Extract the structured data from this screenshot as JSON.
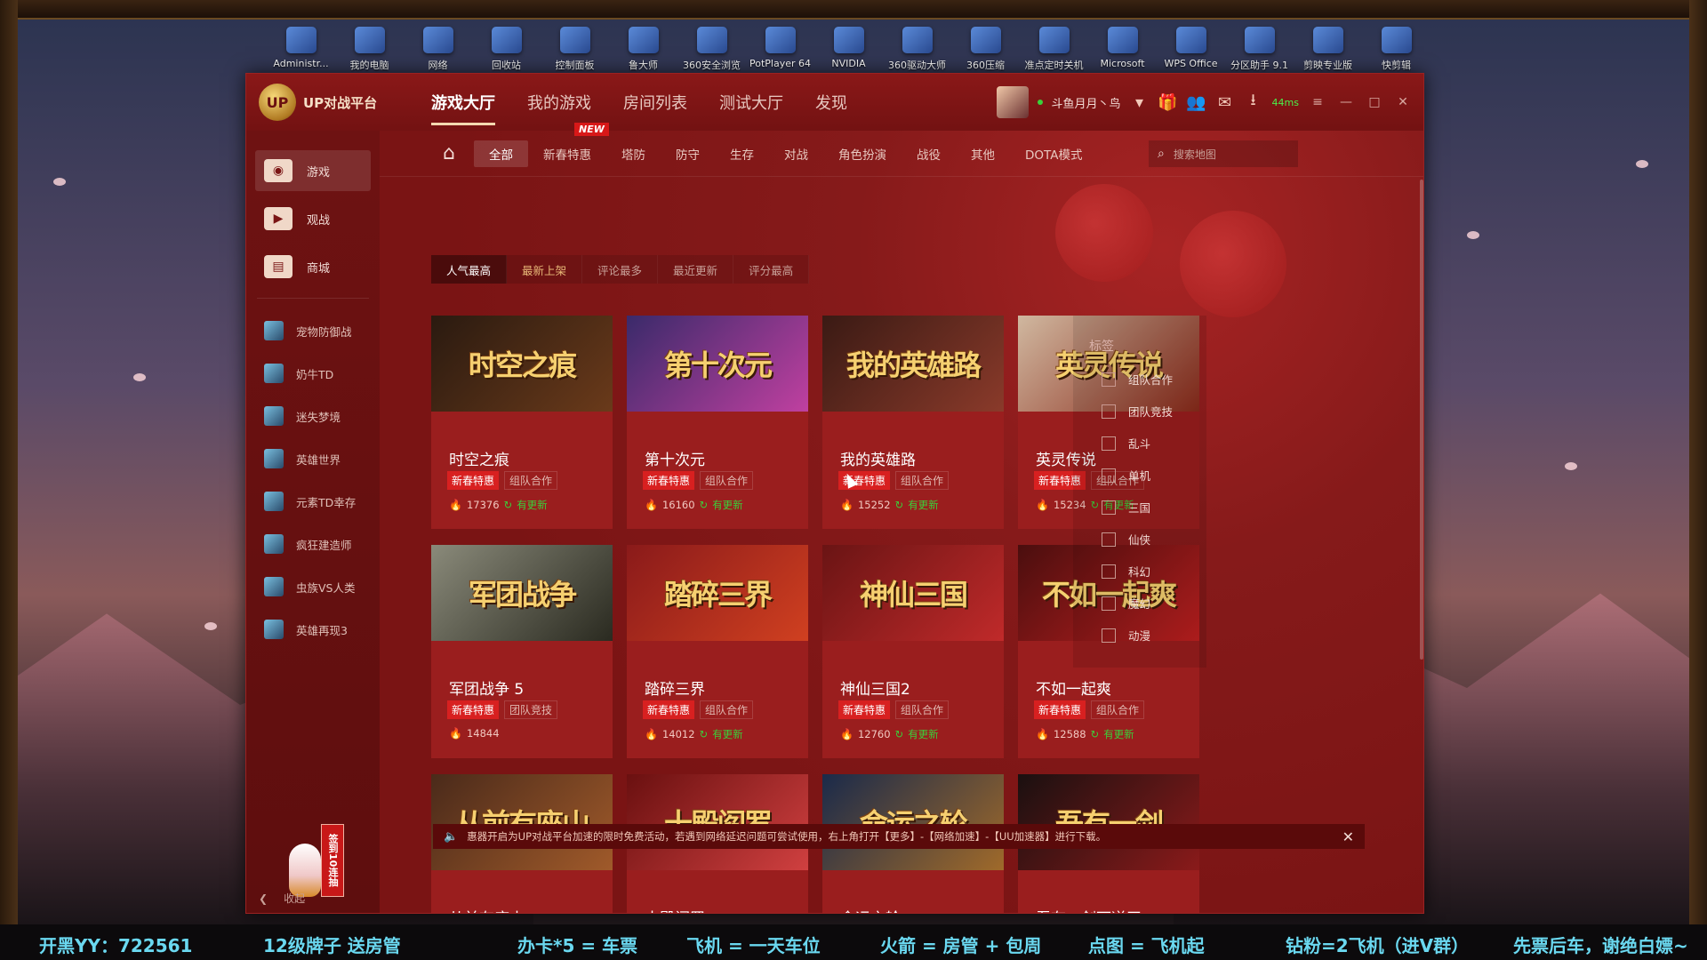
{
  "desktop": {
    "icons": [
      "Administr...",
      "我的电脑",
      "网络",
      "回收站",
      "控制面板",
      "鲁大师",
      "360安全浏览",
      "PotPlayer 64",
      "NVIDIA",
      "360驱动大师",
      "360压缩",
      "准点定时关机",
      "Microsoft",
      "WPS Office",
      "分区助手 9.1",
      "剪映专业版",
      "快剪辑"
    ]
  },
  "app": {
    "logo_text": "UP",
    "name": "UP对战平台",
    "nav": [
      "游戏大厅",
      "我的游戏",
      "房间列表",
      "测试大厅",
      "发现"
    ],
    "user": {
      "name": "斗鱼月月丶鸟",
      "ping": "44ms"
    },
    "window_buttons": [
      "≡",
      "—",
      "□",
      "✕"
    ]
  },
  "sidebar": {
    "main": [
      {
        "label": "游戏",
        "icon": "gamepad-icon",
        "glyph": "◉"
      },
      {
        "label": "观战",
        "icon": "play-icon",
        "glyph": "▶"
      },
      {
        "label": "商城",
        "icon": "shop-icon",
        "glyph": "▤"
      }
    ],
    "games": [
      "宠物防御战",
      "奶牛TD",
      "迷失梦境",
      "英雄世界",
      "元素TD幸存",
      "疯狂建造师",
      "虫族VS人类",
      "英雄再现3"
    ],
    "checkin": "签到10连抽",
    "collapse_label": "收起"
  },
  "subnav": {
    "categories": [
      "全部",
      "新春特惠",
      "塔防",
      "防守",
      "生存",
      "对战",
      "角色扮演",
      "战役",
      "其他",
      "DOTA模式"
    ],
    "new_badge": "NEW",
    "search_placeholder": "搜索地图"
  },
  "sort_tabs": [
    "人气最高",
    "最新上架",
    "评论最多",
    "最近更新",
    "评分最高"
  ],
  "games": [
    {
      "title": "时空之痕",
      "logo": "时空之痕",
      "hot": "新春特惠",
      "tag": "组队合作",
      "count": "17376",
      "update": "有更新",
      "c1": "#2a1a10",
      "c2": "#6a3a1a"
    },
    {
      "title": "第十次元",
      "logo": "第十次元",
      "hot": "新春特惠",
      "tag": "组队合作",
      "count": "16160",
      "update": "有更新",
      "c1": "#3a2a6a",
      "c2": "#c040a0"
    },
    {
      "title": "我的英雄路",
      "logo": "我的英雄路",
      "hot": "新春特惠",
      "tag": "组队合作",
      "count": "15252",
      "update": "有更新",
      "c1": "#3a1a14",
      "c2": "#8a3a2a"
    },
    {
      "title": "英灵传说",
      "logo": "英灵传说",
      "hot": "新春特惠",
      "tag": "组队合作",
      "count": "15234",
      "update": "有更新",
      "c1": "#d0b8a0",
      "c2": "#8a2a1a"
    },
    {
      "title": "军团战争 5",
      "logo": "军团战争",
      "hot": "新春特惠",
      "tag": "团队竞技",
      "count": "14844",
      "update": "",
      "c1": "#8a8a7a",
      "c2": "#2a2a20"
    },
    {
      "title": "踏碎三界",
      "logo": "踏碎三界",
      "hot": "新春特惠",
      "tag": "组队合作",
      "count": "14012",
      "update": "有更新",
      "c1": "#8a1a1a",
      "c2": "#d04020"
    },
    {
      "title": "神仙三国2",
      "logo": "神仙三国",
      "hot": "新春特惠",
      "tag": "组队合作",
      "count": "12760",
      "update": "有更新",
      "c1": "#6a1414",
      "c2": "#c02a2a"
    },
    {
      "title": "不如一起爽",
      "logo": "不如一起爽",
      "hot": "新春特惠",
      "tag": "组队合作",
      "count": "12588",
      "update": "有更新",
      "c1": "#4a0e0e",
      "c2": "#c02020"
    },
    {
      "title": "从前有座山",
      "logo": "从前有座山",
      "hot": "",
      "tag": "",
      "count": "",
      "update": "",
      "c1": "#4a2a1a",
      "c2": "#a05a2a"
    },
    {
      "title": "十殿阎罗",
      "logo": "十殿阎罗",
      "hot": "",
      "tag": "",
      "count": "",
      "update": "",
      "c1": "#6a1010",
      "c2": "#d04040"
    },
    {
      "title": "命运之轮",
      "logo": "命运之轮",
      "hot": "",
      "tag": "",
      "count": "",
      "update": "",
      "c1": "#1a2a4a",
      "c2": "#a06a2a"
    },
    {
      "title": "吾有一剑可逆天",
      "logo": "吾有一剑",
      "hot": "",
      "tag": "",
      "count": "",
      "update": "",
      "c1": "#1a1010",
      "c2": "#8a1a1a"
    }
  ],
  "labels_panel": {
    "title": "标签",
    "items": [
      "组队合作",
      "团队竞技",
      "乱斗",
      "单机",
      "三国",
      "仙侠",
      "科幻",
      "魔幻",
      "动漫"
    ]
  },
  "notice": "惠器开启为UP对战平台加速的限时免费活动，若遇到网络延迟问题可尝试使用，右上角打开【更多】-【网络加速】-【UU加速器】进行下载。",
  "ticker": [
    "开黑YY：722561",
    "12级牌子 送房管",
    "办卡*5 = 车票",
    "飞机 = 一天车位",
    "火箭 = 房管 + 包周",
    "点图 = 飞机起",
    "钻粉=2飞机（进V群）",
    "先票后车，谢绝白嫖~"
  ]
}
